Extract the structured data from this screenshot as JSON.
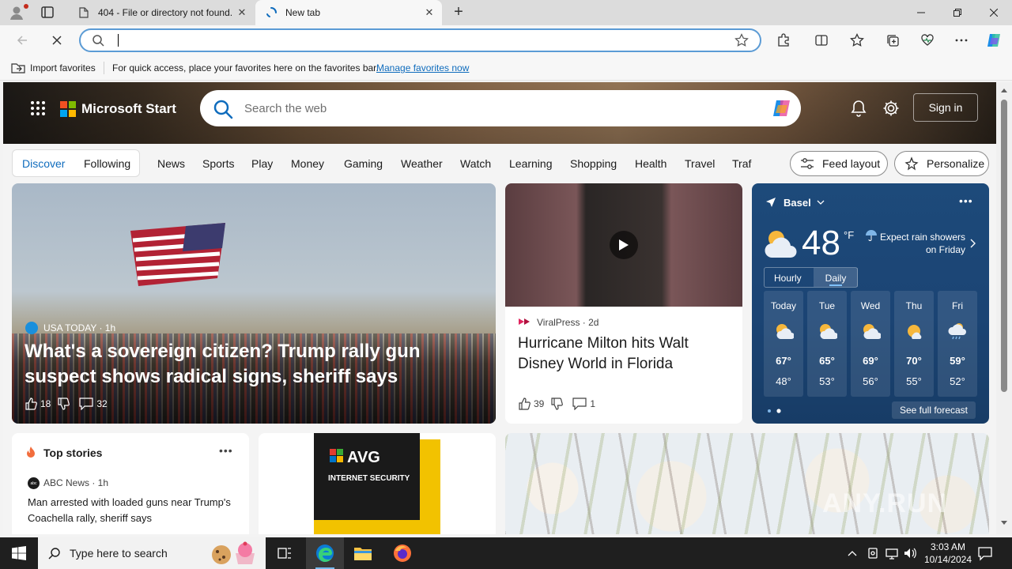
{
  "browser": {
    "tabs": [
      {
        "title": "404 - File or directory not found.",
        "active": false
      },
      {
        "title": "New tab",
        "active": true
      }
    ],
    "address": {
      "value": "",
      "placeholder": ""
    },
    "favorites_bar": {
      "import_label": "Import favorites",
      "message": "For quick access, place your favorites here on the favorites bar.",
      "link": "Manage favorites now"
    }
  },
  "header": {
    "brand": "Microsoft Start",
    "search_placeholder": "Search the web",
    "signin_label": "Sign in"
  },
  "nav": {
    "segment": [
      "Discover",
      "Following"
    ],
    "items": [
      "News",
      "Sports",
      "Play",
      "Money",
      "Gaming",
      "Weather",
      "Watch",
      "Learning",
      "Shopping",
      "Health",
      "Travel",
      "Traf"
    ],
    "feed_layout_label": "Feed layout",
    "personalize_label": "Personalize"
  },
  "hero": {
    "source": "USA TODAY",
    "age": "1h",
    "source_line": "USA TODAY · 1h",
    "headline": "What's a sovereign citizen? Trump rally gun suspect shows radical signs, sheriff says",
    "likes": "18",
    "comments": "32"
  },
  "story2": {
    "source_line": "ViralPress · 2d",
    "headline": "Hurricane Milton hits Walt Disney World in Florida",
    "likes": "39",
    "comments": "1"
  },
  "weather": {
    "location": "Basel",
    "temp": "48",
    "unit": "°F",
    "note": "Expect rain showers on Friday",
    "tab_hourly": "Hourly",
    "tab_daily": "Daily",
    "days": [
      {
        "name": "Today",
        "hi": "67°",
        "lo": "48°",
        "icon": "partly-sunny-icon"
      },
      {
        "name": "Tue",
        "hi": "65°",
        "lo": "53°",
        "icon": "partly-sunny-icon"
      },
      {
        "name": "Wed",
        "hi": "69°",
        "lo": "56°",
        "icon": "partly-sunny-icon"
      },
      {
        "name": "Thu",
        "hi": "70°",
        "lo": "55°",
        "icon": "sunny-icon"
      },
      {
        "name": "Fri",
        "hi": "59°",
        "lo": "52°",
        "icon": "rain-icon"
      }
    ],
    "full_forecast": "See full forecast"
  },
  "top_stories": {
    "title": "Top stories",
    "source_line": "ABC News · 1h",
    "headline": "Man arrested with loaded guns near Trump's Coachella rally, sheriff says"
  },
  "ad": {
    "brand": "AVG",
    "product": "INTERNET SECURITY"
  },
  "watermark": "ANY.RUN",
  "taskbar": {
    "search_placeholder": "Type here to search",
    "time": "3:03 AM",
    "date": "10/14/2024"
  },
  "colors": {
    "accent": "#0f6cbd",
    "address_focus": "#5b9bd5",
    "weather_bg": "#1d4a7a",
    "taskbar_bg": "#1f1f1f"
  }
}
